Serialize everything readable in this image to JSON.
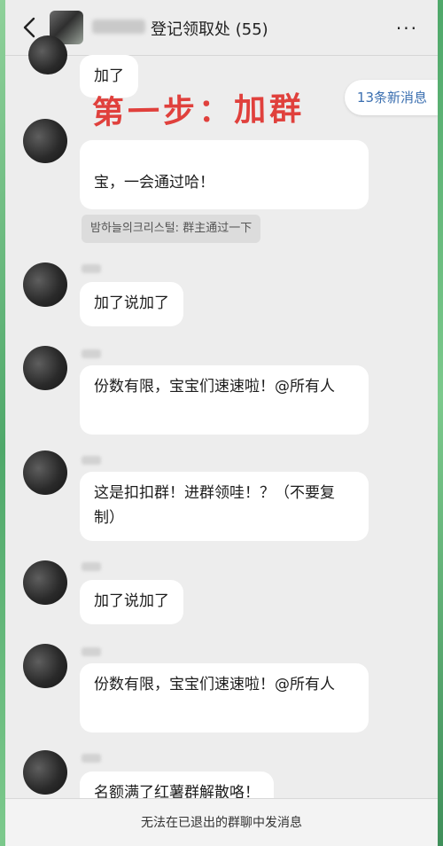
{
  "header": {
    "title": "登记领取处 (55)",
    "more_label": "···"
  },
  "overlay_text": "第一步：加群",
  "new_messages": "13条新消息",
  "notice": "밤하늘의크리스털: 群主通过一下",
  "messages": [
    {
      "text": "加了"
    },
    {
      "text": "宝，一会通过哈！"
    },
    {
      "text": "加了说加了"
    },
    {
      "text": "份数有限，宝宝们速速啦！@所有人"
    },
    {
      "text": "这是扣扣群！进群领哇！？（不要复制）"
    },
    {
      "text": "加了说加了"
    },
    {
      "text": "份数有限，宝宝们速速啦！@所有人"
    },
    {
      "text": "名额满了红薯群解散咯！"
    }
  ],
  "footer": "无法在已退出的群聊中发消息",
  "colors": {
    "accent_red": "#e0403c",
    "link_blue": "#3b6fb0"
  }
}
